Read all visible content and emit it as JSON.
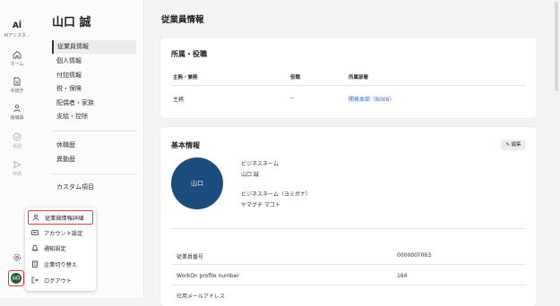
{
  "rail": {
    "logo_text": "AIアシスタ...",
    "items": [
      {
        "label": "ホーム",
        "icon": "home-icon"
      },
      {
        "label": "手続き",
        "icon": "document-icon"
      },
      {
        "label": "組織図",
        "icon": "org-chart-icon"
      },
      {
        "label": "承認",
        "icon": "check-circle-icon"
      },
      {
        "label": "申請",
        "icon": "send-icon"
      }
    ],
    "avatar_text": "山口"
  },
  "subnav": {
    "employee_name": "山口 誠",
    "group1": [
      "従業員情報",
      "個人情報",
      "付加情報",
      "税・保険",
      "配偶者・家族",
      "支給・控除"
    ],
    "group2": [
      "休職歴",
      "異動歴"
    ],
    "group3": [
      "カスタム項目"
    ],
    "active": "従業員情報"
  },
  "main": {
    "title": "従業員情報",
    "affiliation": {
      "title": "所属・役職",
      "headers": [
        "主務・兼務",
        "役職",
        "所属部署"
      ],
      "row": [
        "主務",
        "--",
        "開発本部（B008）"
      ]
    },
    "basic": {
      "title": "基本情報",
      "edit_label": "編集",
      "photo_text": "山口",
      "business_name_label": "ビジネスネーム",
      "business_name_value": "山口 誠",
      "business_kana_label": "ビジネスネーム（ヨミガナ）",
      "business_kana_value": "ヤマグチ マコト",
      "rows": [
        {
          "label": "従業員番号",
          "value": "000000T063"
        },
        {
          "label": "WorkOn profile number",
          "value": "164"
        },
        {
          "label": "社用メールアドレス",
          "value": ""
        }
      ]
    }
  },
  "popup_menu": {
    "items": [
      {
        "label": "従業員情報詳細",
        "icon": "person-icon"
      },
      {
        "label": "アカウント設定",
        "icon": "id-card-icon"
      },
      {
        "label": "通知設定",
        "icon": "bell-icon"
      },
      {
        "label": "企業切り替え",
        "icon": "building-icon"
      },
      {
        "label": "ログアウト",
        "icon": "logout-icon"
      }
    ]
  },
  "colors": {
    "accent_link": "#2a62c9",
    "highlight_border": "#e53935",
    "photo_bg": "#1b4c7e"
  }
}
